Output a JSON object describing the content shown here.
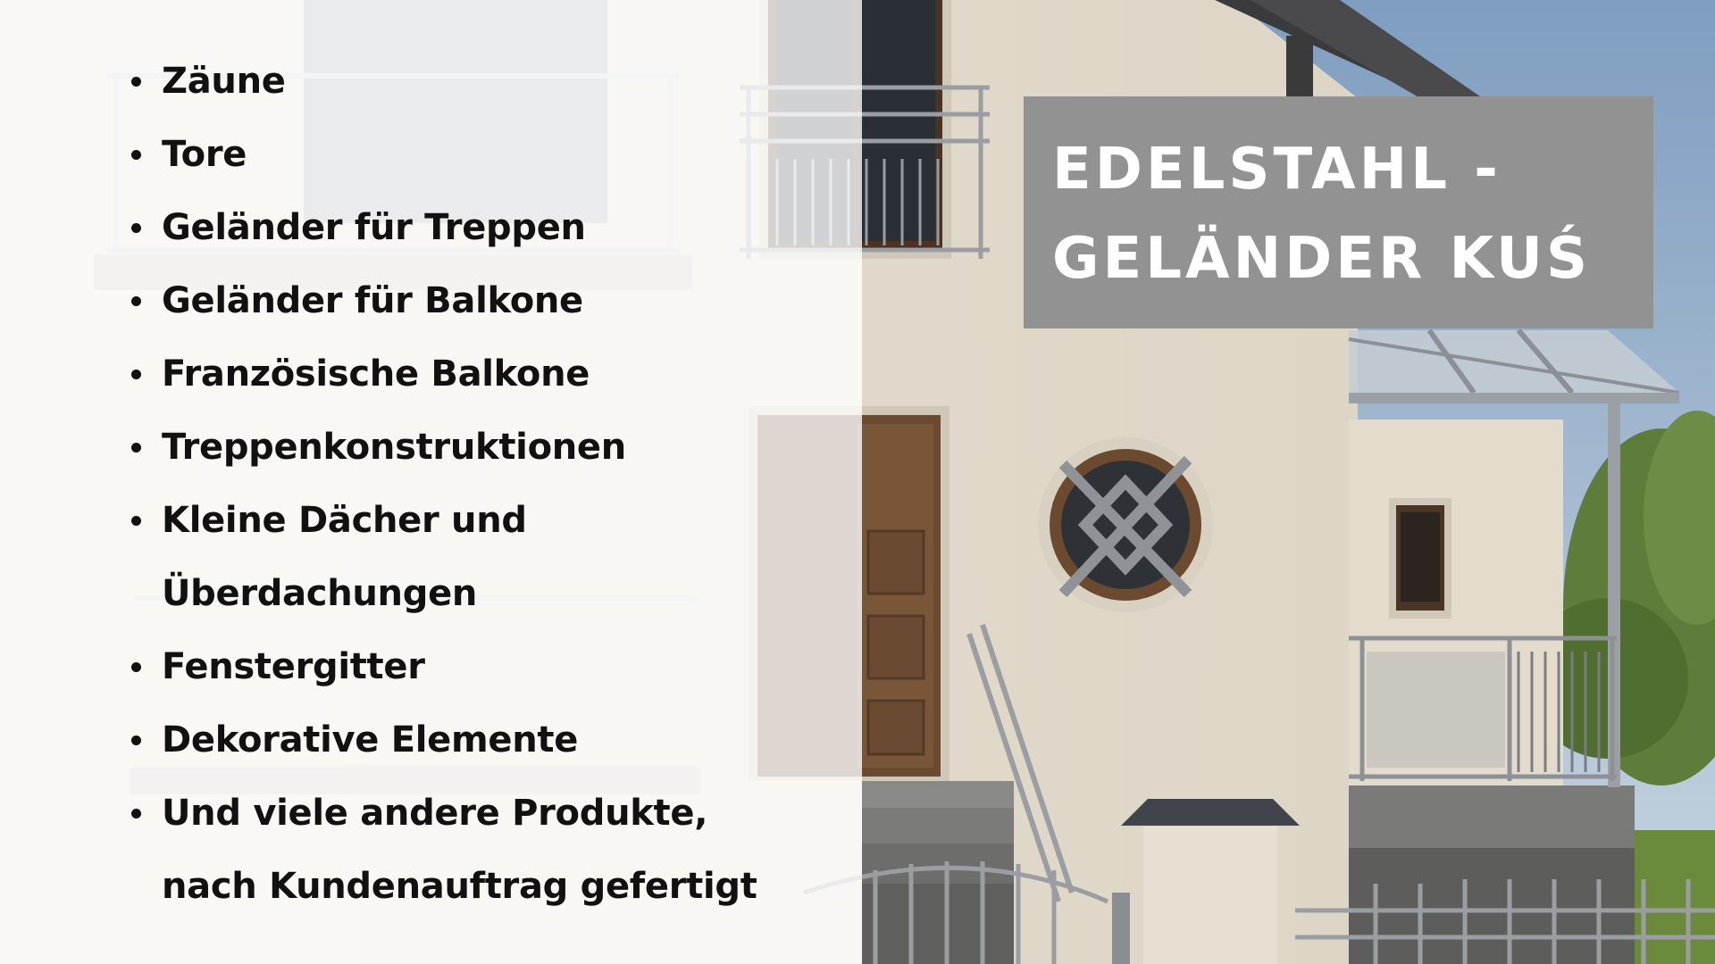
{
  "title": {
    "line1": "EDELSTAHL -",
    "line2": "GELÄNDER KUŚ"
  },
  "products": [
    {
      "lines": [
        "Zäune"
      ]
    },
    {
      "lines": [
        "Tore"
      ]
    },
    {
      "lines": [
        "Geländer für Treppen"
      ]
    },
    {
      "lines": [
        "Geländer für Balkone"
      ]
    },
    {
      "lines": [
        "Französische Balkone"
      ]
    },
    {
      "lines": [
        "Treppenkonstruktionen"
      ]
    },
    {
      "lines": [
        "Kleine Dächer und",
        "Überdachungen"
      ]
    },
    {
      "lines": [
        "Fenstergitter"
      ]
    },
    {
      "lines": [
        "Dekorative Elemente"
      ]
    },
    {
      "lines": [
        "Und viele andere Produkte,",
        "nach Kundenauftrag gefertigt"
      ]
    }
  ],
  "colors": {
    "title_box": "#929292",
    "title_text": "#ffffff",
    "list_text": "#111111",
    "wall": "#e4ddd0",
    "sky": "#9db3cc"
  }
}
